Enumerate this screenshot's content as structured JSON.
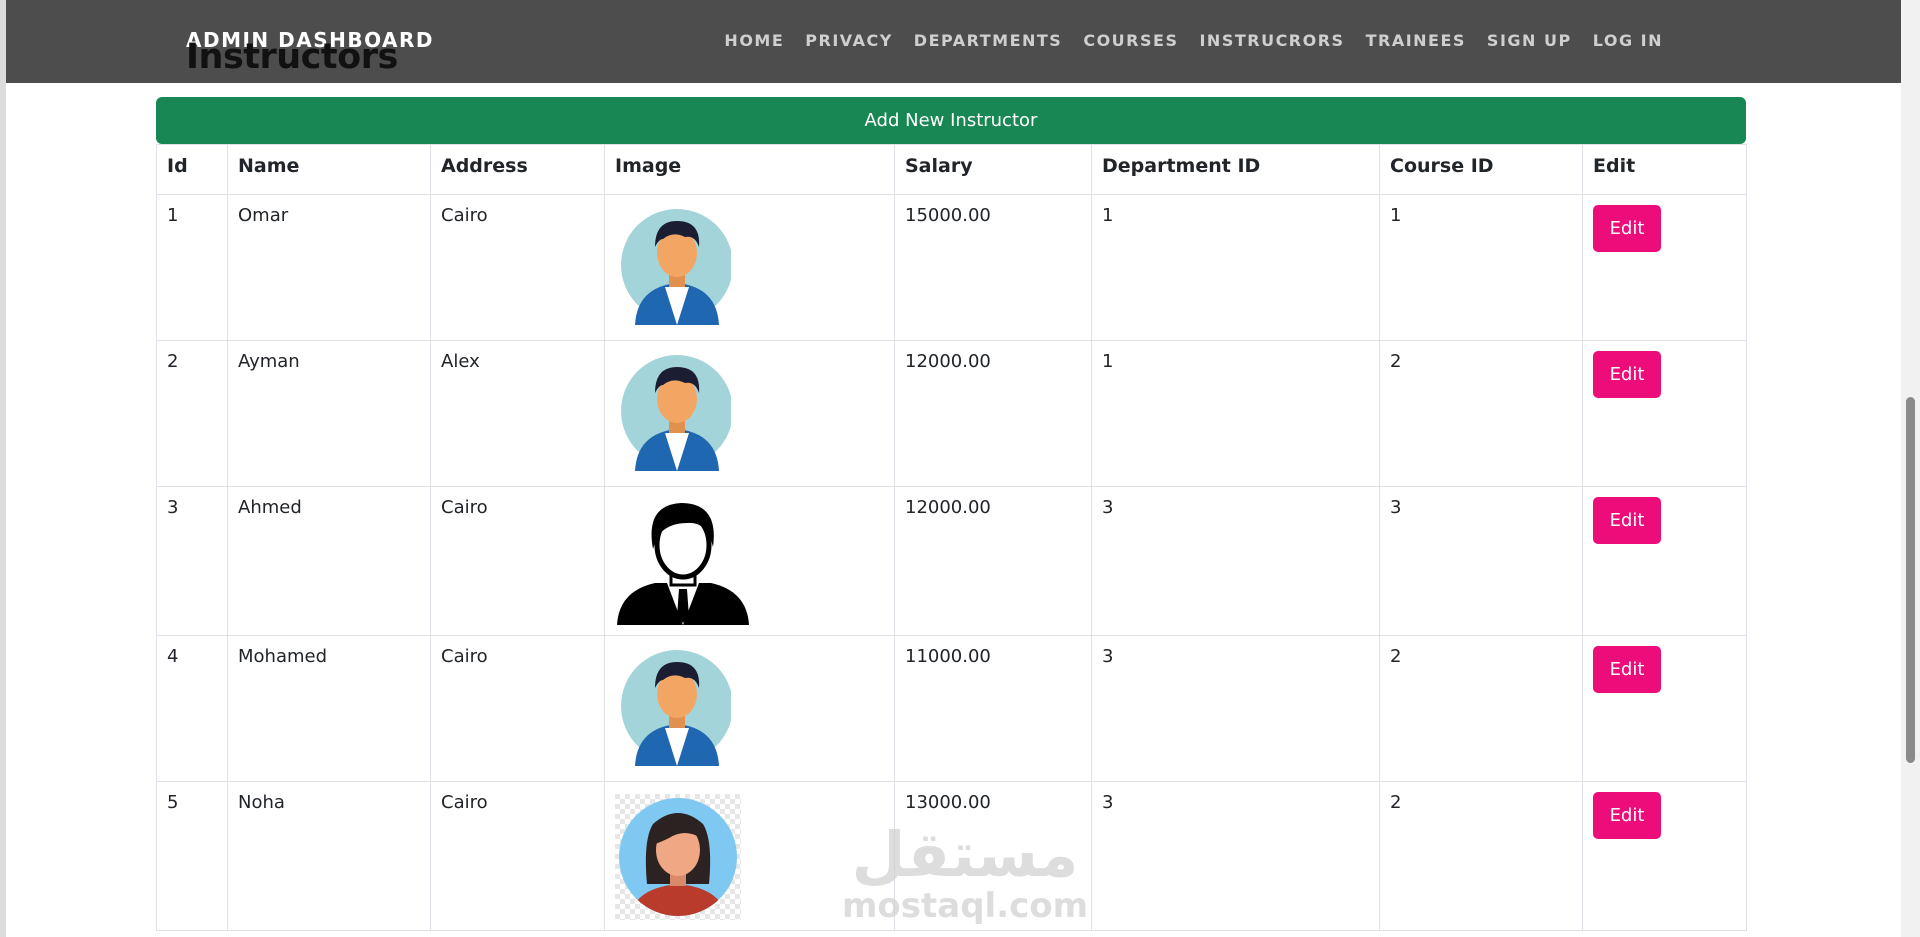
{
  "nav": {
    "brand": "ADMIN DASHBOARD",
    "links": [
      "HOME",
      "PRIVACY",
      "DEPARTMENTS",
      "COURSES",
      "INSTRUCRORS",
      "TRAINEES",
      "SIGN UP",
      "LOG IN"
    ]
  },
  "page": {
    "title": "Instructors",
    "add_button": "Add New Instructor"
  },
  "table": {
    "headers": [
      "Id",
      "Name",
      "Address",
      "Image",
      "Salary",
      "Department ID",
      "Course ID",
      "Edit"
    ],
    "rows": [
      {
        "id": "1",
        "name": "Omar",
        "address": "Cairo",
        "image": "male-avatar-icon",
        "salary": "15000.00",
        "department_id": "1",
        "course_id": "1",
        "edit": "Edit"
      },
      {
        "id": "2",
        "name": "Ayman",
        "address": "Alex",
        "image": "male-avatar-icon",
        "salary": "12000.00",
        "department_id": "1",
        "course_id": "2",
        "edit": "Edit"
      },
      {
        "id": "3",
        "name": "Ahmed",
        "address": "Cairo",
        "image": "businessman-silhouette-icon",
        "salary": "12000.00",
        "department_id": "3",
        "course_id": "3",
        "edit": "Edit"
      },
      {
        "id": "4",
        "name": "Mohamed",
        "address": "Cairo",
        "image": "male-avatar-icon",
        "salary": "11000.00",
        "department_id": "3",
        "course_id": "2",
        "edit": "Edit"
      },
      {
        "id": "5",
        "name": "Noha",
        "address": "Cairo",
        "image": "female-avatar-icon",
        "salary": "13000.00",
        "department_id": "3",
        "course_id": "2",
        "edit": "Edit"
      }
    ]
  },
  "watermark": {
    "arabic": "مستقل",
    "latin": "mostaql.com"
  },
  "colors": {
    "navbar": "#4d4d4d",
    "add_button": "#198754",
    "edit_button": "#ec0c7a"
  }
}
